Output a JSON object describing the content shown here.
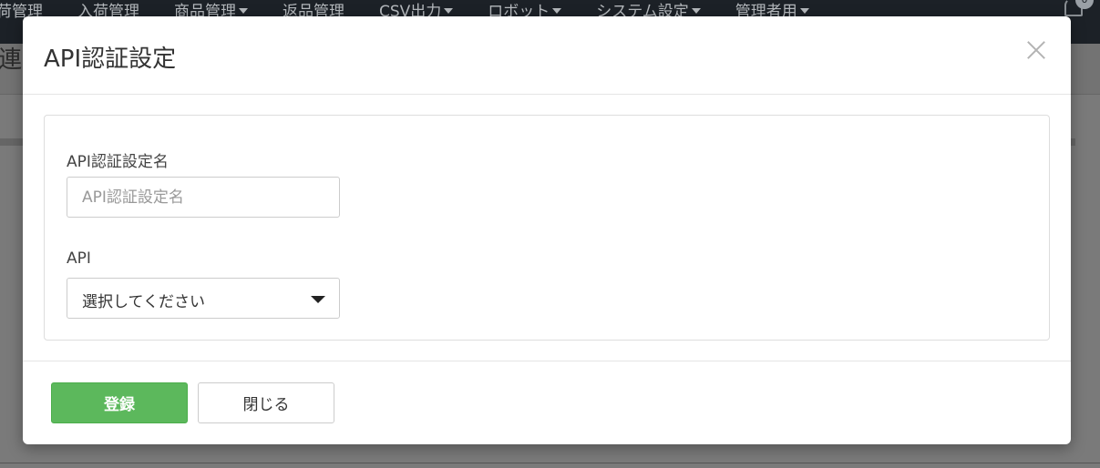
{
  "navbar": {
    "items": [
      {
        "label": "荷管理",
        "dropdown": false
      },
      {
        "label": "入荷管理",
        "dropdown": false
      },
      {
        "label": "商品管理",
        "dropdown": true
      },
      {
        "label": "返品管理",
        "dropdown": false
      },
      {
        "label": "CSV出力",
        "dropdown": true
      },
      {
        "label": "ロボット",
        "dropdown": true
      },
      {
        "label": "システム設定",
        "dropdown": true
      },
      {
        "label": "管理者用",
        "dropdown": true
      }
    ],
    "notification_count": "0"
  },
  "background": {
    "page_title": "連"
  },
  "modal": {
    "title": "API認証設定",
    "fields": {
      "name_label": "API認証設定名",
      "name_placeholder": "API認証設定名",
      "name_value": "",
      "api_label": "API",
      "api_selected": "選択してください"
    },
    "buttons": {
      "submit": "登録",
      "close": "閉じる"
    }
  },
  "colors": {
    "primary": "#5cb85c",
    "navbar": "#1c2127",
    "overlay": "#6f6f6f"
  }
}
